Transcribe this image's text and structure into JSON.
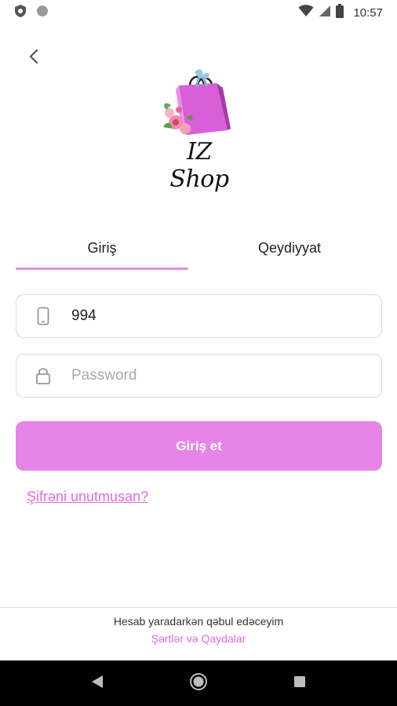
{
  "status_bar": {
    "time": "10:57"
  },
  "brand": {
    "logo_text": "IZ Shop"
  },
  "tabs": [
    {
      "label": "Giriş"
    },
    {
      "label": "Qeydiyyat"
    }
  ],
  "form": {
    "phone_value": "994",
    "password_placeholder": "Password",
    "submit_label": "Giriş et",
    "forgot_label": "Şifrəni unutmusan?"
  },
  "footer": {
    "text": "Hesab yaradarkən qəbul edəceyim",
    "terms_label": "Şərtlər və Qaydalar"
  },
  "colors": {
    "accent": "#e784e8",
    "link": "#e06be0"
  },
  "icons": [
    "shield-icon",
    "circle-icon",
    "wifi-icon",
    "signal-icon",
    "battery-icon",
    "back-icon",
    "phone-icon",
    "lock-icon",
    "nav-back-icon",
    "nav-home-icon",
    "nav-recents-icon"
  ]
}
